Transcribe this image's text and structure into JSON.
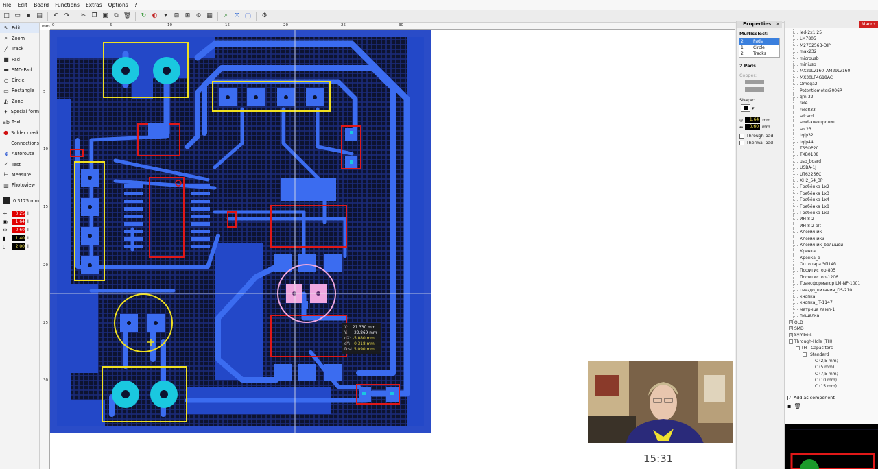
{
  "menu": [
    "File",
    "Edit",
    "Board",
    "Functions",
    "Extras",
    "Options",
    "?"
  ],
  "tools": [
    {
      "label": "Edit",
      "icon": "cursor-icon",
      "active": true
    },
    {
      "label": "Zoom",
      "icon": "magnifier-icon"
    },
    {
      "label": "Track",
      "icon": "track-icon"
    },
    {
      "label": "Pad",
      "icon": "pad-icon"
    },
    {
      "label": "SMD-Pad",
      "icon": "smd-pad-icon"
    },
    {
      "label": "Circle",
      "icon": "circle-icon"
    },
    {
      "label": "Rectangle",
      "icon": "rectangle-icon"
    },
    {
      "label": "Zone",
      "icon": "zone-icon"
    },
    {
      "label": "Special form",
      "icon": "special-form-icon"
    },
    {
      "label": "Text",
      "icon": "text-icon"
    },
    {
      "label": "Solder mask",
      "icon": "solder-mask-icon"
    },
    {
      "label": "Connections",
      "icon": "connections-icon"
    },
    {
      "label": "Autoroute",
      "icon": "autoroute-icon"
    },
    {
      "label": "Test",
      "icon": "test-icon"
    },
    {
      "label": "Measure",
      "icon": "measure-icon"
    },
    {
      "label": "Photoview",
      "icon": "photoview-icon"
    }
  ],
  "grid_label": "0.3175 mm",
  "params": [
    {
      "icon": "track-width-icon",
      "value": "0.25",
      "unit": "II"
    },
    {
      "icon": "pad-outer-icon",
      "value": "1.64",
      "unit": "II"
    },
    {
      "icon": "pad-inner-icon",
      "value": "0.60",
      "unit": "II"
    },
    {
      "icon": "smd-width-icon",
      "value": "1.40",
      "unit": "II"
    },
    {
      "icon": "smd-height-icon",
      "value": "2.00",
      "unit": "II"
    }
  ],
  "ruler": {
    "unit": "mm",
    "x_labels": [
      "0",
      "5",
      "10",
      "15",
      "20",
      "25",
      "30"
    ],
    "y_labels": [
      "5",
      "10",
      "15",
      "20",
      "25",
      "30"
    ]
  },
  "cursor_info": {
    "x_label": "X:",
    "x": "21.330 mm",
    "y_label": "Y:",
    "y": "-22.869 mm",
    "dx_label": "dX:",
    "dx": "-5.080 mm",
    "dy_label": "dY:",
    "dy": "-0.318 mm",
    "dist_label": "Dist:",
    "dist": "5.090 mm"
  },
  "properties": {
    "title": "Properties",
    "close": "×",
    "multiselect": "Multiselect:",
    "items": [
      {
        "count": "2",
        "label": "Pads",
        "selected": true
      },
      {
        "count": "1",
        "label": "Circle"
      },
      {
        "count": "2",
        "label": "Tracks"
      }
    ],
    "group_title": "2 Pads",
    "copper_label": "Copper:",
    "shape_label": "Shape:",
    "outer": "1.64",
    "inner": "0.60",
    "unit": "mm",
    "through_pad": "Through pad",
    "thermal_pad": "Thermal pad"
  },
  "macro": {
    "title": "Macro",
    "items": [
      "led-2x1.25",
      "LM7805",
      "M27C256B-DIP",
      "max232",
      "microusb",
      "miniusb",
      "MX29LV160_AM29LV160",
      "MX30LF4G18AC",
      "Omega2",
      "Potentiometer3006P",
      "qfn-32",
      "rele",
      "rele833",
      "sdcard",
      "smd-электролит",
      "sot23",
      "tqfp32",
      "tqfp44",
      "TSSOP20",
      "TXB0108",
      "usb_board",
      "USBA-1J",
      "UT62256C",
      "XH2_54_3P",
      "Гребёнка 1x2",
      "Гребёнка 1x3",
      "Гребёнка 1x4",
      "Гребёнка 1x8",
      "Гребёнка 1x9",
      "ИН-8-2",
      "ИН-8-2-alt",
      "Клеммник",
      "Клеммник3",
      "Клеммник_большой",
      "Кренка",
      "Кренка_б",
      "Оптопара ЭП14б",
      "Пофигистор-805",
      "Пофигистор-1206",
      "Трансформатор LM-NP-1001",
      "гнездо_питания_DS-210",
      "кнопка",
      "кнопка_IT-1147",
      "матрица ламп-1",
      "пищалка"
    ],
    "tree": [
      {
        "label": "OLD",
        "level": 0,
        "expander": "+"
      },
      {
        "label": "SMD",
        "level": 0,
        "expander": "+"
      },
      {
        "label": "Symbols",
        "level": 0,
        "expander": "+"
      },
      {
        "label": "Through-Hole (TH)",
        "level": 0,
        "expander": "−"
      },
      {
        "label": "TH - Capacitors",
        "level": 1,
        "expander": "−"
      },
      {
        "label": "_Standard",
        "level": 2,
        "expander": "−"
      },
      {
        "label": "C (2,5 mm)",
        "level": 3,
        "expander": ""
      },
      {
        "label": "C (5 mm)",
        "level": 3,
        "expander": ""
      },
      {
        "label": "C (7,5 mm)",
        "level": 3,
        "expander": ""
      },
      {
        "label": "C (10 mm)",
        "level": 3,
        "expander": ""
      },
      {
        "label": "C (15 mm)",
        "level": 3,
        "expander": ""
      }
    ],
    "add_as_component": "Add as component"
  },
  "timestamp": "15:31",
  "colors": {
    "board": "#1d3fb0",
    "copper": "#3b6cf0",
    "silk": "#f0e020",
    "pad": "#1ac8e0",
    "smd": "#e01818",
    "selected": "#f0a8e0"
  }
}
